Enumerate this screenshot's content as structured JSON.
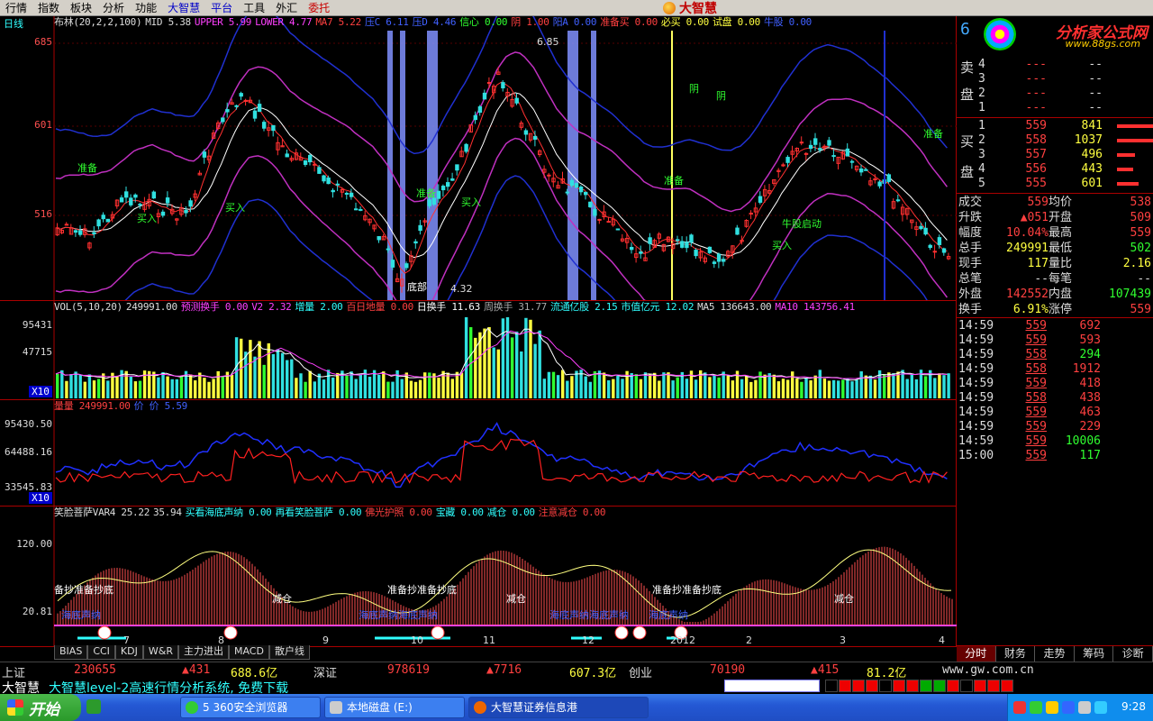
{
  "menu": {
    "items": [
      "行情",
      "指数",
      "板块",
      "分析",
      "功能",
      "大智慧",
      "平台",
      "工具",
      "外汇",
      "委托"
    ],
    "brand": "大智慧"
  },
  "kline": {
    "period_label": "日线",
    "header": [
      {
        "t": "布林(20,2,2,100)",
        "c": "#ddd"
      },
      {
        "t": "MID 5.38",
        "c": "#ddd"
      },
      {
        "t": "UPPER 5.99",
        "c": "#ff40ff"
      },
      {
        "t": "LOWER 4.77",
        "c": "#ff40ff"
      },
      {
        "t": "MA7 5.22",
        "c": "#ff4040"
      },
      {
        "t": "压C 6.11",
        "c": "#4060ff"
      },
      {
        "t": "压D 4.46",
        "c": "#4060ff"
      },
      {
        "t": "信心 0.00",
        "c": "#30ff30"
      },
      {
        "t": "阴 1.00",
        "c": "#ff4040"
      },
      {
        "t": "阳A 0.00",
        "c": "#4060ff"
      },
      {
        "t": "准备买 0.00",
        "c": "#ff4040"
      },
      {
        "t": "必买 0.00",
        "c": "#ffff40"
      },
      {
        "t": "试盘 0.00",
        "c": "#ffff40"
      },
      {
        "t": "牛股 0.00",
        "c": "#4060ff"
      }
    ],
    "y_ticks": [
      "685",
      "601",
      "516"
    ],
    "annotations": [
      {
        "text": "准备",
        "c": "#30ff30"
      },
      {
        "text": "买入",
        "c": "#30ff30"
      },
      {
        "text": "买入",
        "c": "#30ff30"
      },
      {
        "text": "准备",
        "c": "#30ff30"
      },
      {
        "text": "买入",
        "c": "#30ff30"
      },
      {
        "text": "底部",
        "c": "#fff"
      },
      {
        "text": "4.32",
        "c": "#ddd"
      },
      {
        "text": "6.85",
        "c": "#ddd"
      },
      {
        "text": "阴",
        "c": "#30ff30"
      },
      {
        "text": "阴",
        "c": "#30ff30"
      },
      {
        "text": "准备",
        "c": "#30ff30"
      },
      {
        "text": "准备",
        "c": "#30ff30"
      },
      {
        "text": "买入",
        "c": "#30ff30"
      },
      {
        "text": "牛股启动",
        "c": "#30ff30"
      }
    ]
  },
  "volume": {
    "header": [
      {
        "t": "VOL(5,10,20)",
        "c": "#ddd"
      },
      {
        "t": "249991.00",
        "c": "#ddd"
      },
      {
        "t": "预测换手 0.00",
        "c": "#ff40ff"
      },
      {
        "t": "V2 2.32",
        "c": "#ff40ff"
      },
      {
        "t": "增量 2.00",
        "c": "#30ffff"
      },
      {
        "t": "百日地量 0.00",
        "c": "#ff4040"
      },
      {
        "t": "日换手 11.63",
        "c": "#fff"
      },
      {
        "t": "周换手 31.77",
        "c": "#aaa"
      },
      {
        "t": "流通亿股 2.15",
        "c": "#30ffff"
      },
      {
        "t": "市值亿元 12.02",
        "c": "#30ffff"
      },
      {
        "t": "MA5 136643.00",
        "c": "#ddd"
      },
      {
        "t": "MA10 143756.41",
        "c": "#ff40ff"
      }
    ],
    "y_ticks": [
      "95431",
      "47715"
    ],
    "unit": "X10"
  },
  "qp": {
    "header": [
      {
        "t": "量量 249991.00",
        "c": "#ff4040"
      },
      {
        "t": "价 价 5.59",
        "c": "#4060ff"
      }
    ],
    "y_ticks": [
      "95430.50",
      "64488.16",
      "33545.83"
    ],
    "unit": "X10"
  },
  "osc": {
    "header": [
      {
        "t": "笑脸菩萨VAR4 25.22",
        "c": "#ddd"
      },
      {
        "t": "35.94",
        "c": "#ddd"
      },
      {
        "t": "买看海底声纳 0.00",
        "c": "#30ffff"
      },
      {
        "t": "再看笑脸菩萨 0.00",
        "c": "#30ffff"
      },
      {
        "t": "佛光护照 0.00",
        "c": "#ff4040"
      },
      {
        "t": "宝藏 0.00",
        "c": "#30ffff"
      },
      {
        "t": "减仓 0.00",
        "c": "#30ffff"
      },
      {
        "t": "注意减仓 0.00",
        "c": "#ff4040"
      }
    ],
    "y_ticks": [
      "120.00",
      "20.81"
    ],
    "labels": [
      {
        "text": "备抄准备抄底",
        "c": "#fff"
      },
      {
        "text": "减仓",
        "c": "#fff"
      },
      {
        "text": "准备抄准备抄底",
        "c": "#fff"
      },
      {
        "text": "减仓",
        "c": "#fff"
      },
      {
        "text": "准备抄准备抄底",
        "c": "#fff"
      },
      {
        "text": "减仓",
        "c": "#fff"
      },
      {
        "text": "海底声纳",
        "c": "#4060ff"
      },
      {
        "text": "海底声纳海底声纳",
        "c": "#4060ff"
      },
      {
        "text": "海底声纳海底声纳",
        "c": "#4060ff"
      },
      {
        "text": "海底声纳",
        "c": "#4060ff"
      }
    ],
    "x_ticks": [
      "7",
      "8",
      "9",
      "10",
      "11",
      "12",
      "2012",
      "2",
      "3",
      "4"
    ]
  },
  "chart_tabs": [
    "BIAS",
    "CCI",
    "KDJ",
    "W&R",
    "主力进出",
    "MACD",
    "散户线"
  ],
  "right": {
    "ad_site": "分析家公式网",
    "ad_url": "www.88gs.com",
    "code_prefix": "6",
    "sell_label": [
      "卖",
      "盘"
    ],
    "buy_label": [
      "买",
      "盘"
    ],
    "sell": [
      {
        "i": "4",
        "p": "---",
        "v": "--"
      },
      {
        "i": "3",
        "p": "---",
        "v": "--"
      },
      {
        "i": "2",
        "p": "---",
        "v": "--"
      },
      {
        "i": "1",
        "p": "---",
        "v": "--"
      }
    ],
    "buy": [
      {
        "i": "1",
        "p": "559",
        "v": "841",
        "bar": 40
      },
      {
        "i": "2",
        "p": "558",
        "v": "1037",
        "bar": 44
      },
      {
        "i": "3",
        "p": "557",
        "v": "496",
        "bar": 20
      },
      {
        "i": "4",
        "p": "556",
        "v": "443",
        "bar": 18
      },
      {
        "i": "5",
        "p": "555",
        "v": "601",
        "bar": 24
      }
    ],
    "info": [
      {
        "k": "成交",
        "v": "559",
        "vc": "red",
        "k2": "均价",
        "v2": "538",
        "v2c": "red"
      },
      {
        "k": "升跌",
        "v": "▲051",
        "vc": "red",
        "k2": "开盘",
        "v2": "509",
        "v2c": "red"
      },
      {
        "k": "幅度",
        "v": "10.04%",
        "vc": "red",
        "k2": "最高",
        "v2": "559",
        "v2c": "red"
      },
      {
        "k": "总手",
        "v": "249991",
        "vc": "yel",
        "k2": "最低",
        "v2": "502",
        "v2c": "grn"
      },
      {
        "k": "现手",
        "v": "117",
        "vc": "yel",
        "k2": "量比",
        "v2": "2.16",
        "v2c": "yel"
      },
      {
        "k": "总笔",
        "v": "--",
        "vc": "wht",
        "k2": "每笔",
        "v2": "--",
        "v2c": "wht"
      },
      {
        "k": "外盘",
        "v": "142552",
        "vc": "red",
        "k2": "内盘",
        "v2": "107439",
        "v2c": "grn"
      },
      {
        "k": "换手",
        "v": "6.91%",
        "vc": "yel",
        "k2": "涨停",
        "v2": "559",
        "v2c": "red"
      }
    ],
    "ticks": [
      {
        "t": "14:59",
        "p": "559",
        "q": "692",
        "qc": "red"
      },
      {
        "t": "14:59",
        "p": "559",
        "q": "593",
        "qc": "red"
      },
      {
        "t": "14:59",
        "p": "558",
        "q": "294",
        "qc": "grn"
      },
      {
        "t": "14:59",
        "p": "558",
        "q": "1912",
        "qc": "red"
      },
      {
        "t": "14:59",
        "p": "559",
        "q": "418",
        "qc": "red"
      },
      {
        "t": "14:59",
        "p": "558",
        "q": "438",
        "qc": "red"
      },
      {
        "t": "14:59",
        "p": "559",
        "q": "463",
        "qc": "red"
      },
      {
        "t": "14:59",
        "p": "559",
        "q": "229",
        "qc": "red"
      },
      {
        "t": "14:59",
        "p": "559",
        "q": "10006",
        "qc": "grn"
      },
      {
        "t": "15:00",
        "p": "559",
        "q": "117",
        "qc": "grn"
      }
    ],
    "tabs": [
      "分时",
      "财务",
      "走势",
      "筹码",
      "诊断"
    ]
  },
  "index_bar": [
    {
      "t": "上证",
      "c": "#ddd"
    },
    {
      "t": "230655",
      "c": "#ff4040"
    },
    {
      "t": "▲431",
      "c": "#ff4040"
    },
    {
      "t": "688.6亿",
      "c": "#ffff40"
    },
    {
      "t": "深证",
      "c": "#ddd"
    },
    {
      "t": "978619",
      "c": "#ff4040"
    },
    {
      "t": "▲7716",
      "c": "#ff4040"
    },
    {
      "t": "607.3亿",
      "c": "#ffff40"
    },
    {
      "t": "创业",
      "c": "#ddd"
    },
    {
      "t": "70190",
      "c": "#ff4040"
    },
    {
      "t": "▲415",
      "c": "#ff4040"
    },
    {
      "t": "81.2亿",
      "c": "#ffff40"
    },
    {
      "t": "www.gw.com.cn",
      "c": "#ddd"
    }
  ],
  "info_bar": {
    "app": "大智慧",
    "message": "大智慧level-2高速行情分析系统, 免费下载"
  },
  "taskbar": {
    "start": "开始",
    "tasks": [
      "5 360安全浏览器",
      "本地磁盘 (E:)",
      "大智慧证券信息港"
    ],
    "clock": "9:28"
  }
}
